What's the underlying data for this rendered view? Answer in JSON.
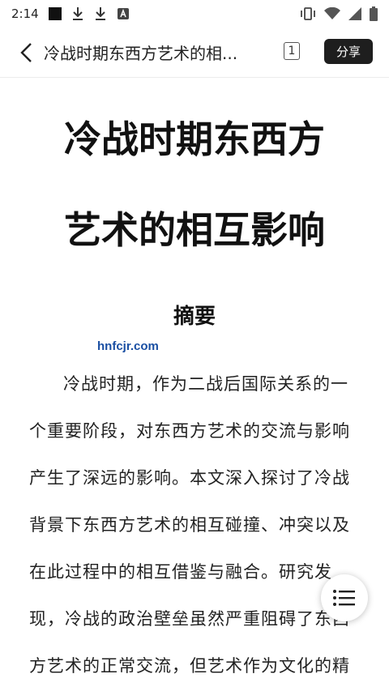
{
  "status_bar": {
    "time": "2:14",
    "left_icons": [
      "black-square-icon",
      "download-icon",
      "download-icon",
      "a-box-icon"
    ],
    "right_icons": [
      "vibrate-icon",
      "wifi-icon",
      "signal-icon",
      "battery-icon"
    ]
  },
  "nav": {
    "title": "冷战时期东西方艺术的相...",
    "page_count": "1",
    "share_label": "分享"
  },
  "document": {
    "title_line1": "冷战时期东西方",
    "title_line2": "艺术的相互影响",
    "abstract_heading": "摘要",
    "watermark": "hnfcjr.com",
    "abstract_text": "冷战时期，作为二战后国际关系的一个重要阶段，对东西方艺术的交流与影响产生了深远的影响。本文深入探讨了冷战背景下东西方艺术的相互碰撞、冲突以及在此过程中的相互借鉴与融合。研究发现，冷战的政治壁垒虽然严重阻碍了东西方艺术的正常交流，但艺术作为文化的精"
  },
  "fab": {
    "icon": "list-menu-icon"
  }
}
